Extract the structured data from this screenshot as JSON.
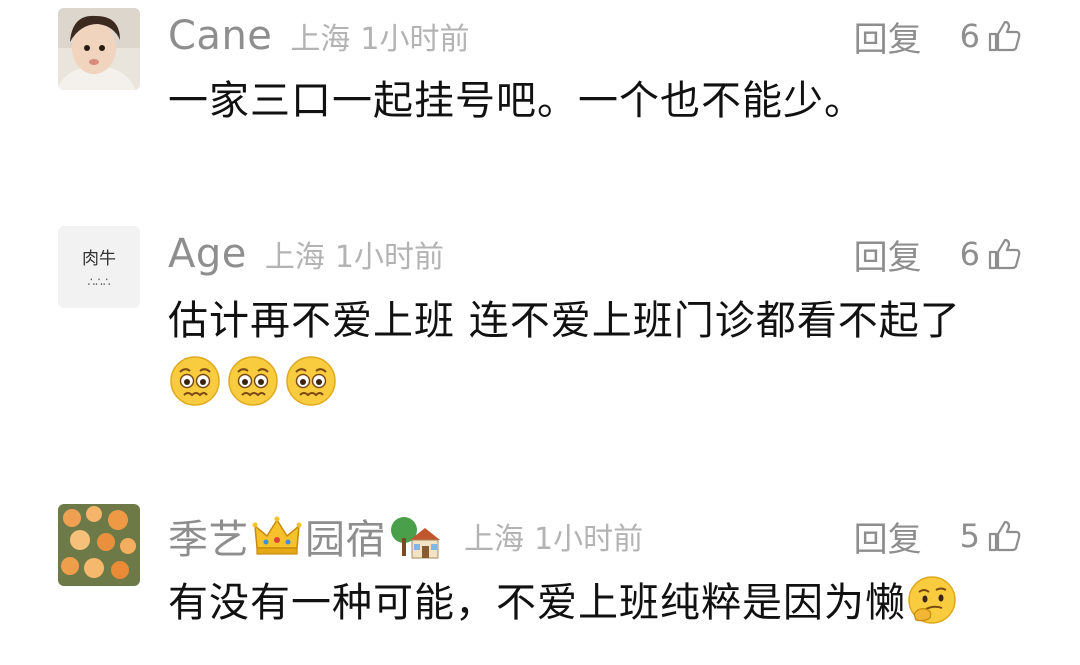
{
  "comments": [
    {
      "username": "Cane",
      "location": "上海",
      "time": "1小时前",
      "reply_label": "回复",
      "likes": "6",
      "text": "一家三口一起挂号吧。一个也不能少。"
    },
    {
      "username": "Age",
      "location": "上海",
      "time": "1小时前",
      "reply_label": "回复",
      "likes": "6",
      "text": "估计再不爱上班 连不爱上班门诊都看不起了",
      "emojis": [
        "worried-face-icon",
        "worried-face-icon",
        "worried-face-icon"
      ],
      "avatar_text_top": "肉牛",
      "avatar_text_bottom": "∴∴∴"
    },
    {
      "username_part1": "季艺",
      "username_part2": "园宿",
      "username_emojis": [
        "crown-icon",
        "house-icon"
      ],
      "location": "上海",
      "time": "1小时前",
      "reply_label": "回复",
      "likes": "5",
      "text": "有没有一种可能，不爱上班纯粹是因为懒",
      "trailing_emoji": "thinking-face-icon"
    }
  ],
  "colors": {
    "meta_gray": "#8e8e8e",
    "location_gray": "#b3b3b3",
    "text": "#111111"
  }
}
